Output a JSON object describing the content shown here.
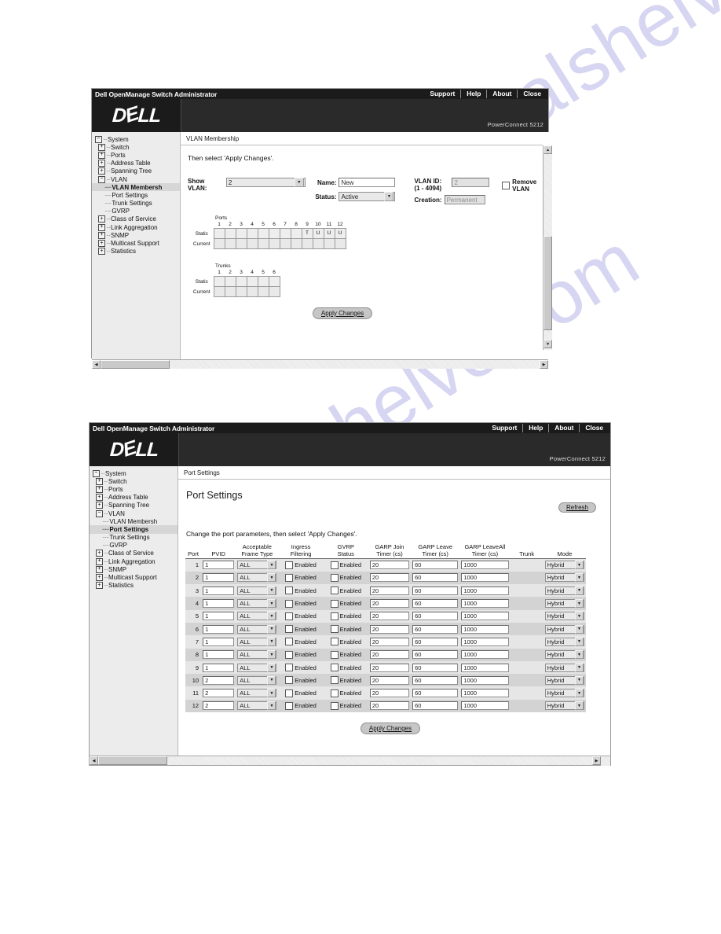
{
  "watermark": {
    "line1": "manualshelve.com",
    "line2": "manualshelve.com"
  },
  "window1": {
    "titlebar": {
      "title": "Dell OpenManage Switch Administrator",
      "links": [
        "Support",
        "Help",
        "About",
        "Close"
      ]
    },
    "banner": {
      "logo": "D⁀LL",
      "model": "PowerConnect 5212"
    },
    "breadcrumb": "VLAN Membership",
    "tree": [
      {
        "label": "System",
        "level": 0,
        "toggle": "−",
        "selected": false
      },
      {
        "label": "Switch",
        "level": 1,
        "toggle": "+",
        "selected": false
      },
      {
        "label": "Ports",
        "level": 1,
        "toggle": "+",
        "selected": false
      },
      {
        "label": "Address Table",
        "level": 1,
        "toggle": "+",
        "selected": false
      },
      {
        "label": "Spanning Tree",
        "level": 1,
        "toggle": "+",
        "selected": false
      },
      {
        "label": "VLAN",
        "level": 1,
        "toggle": "−",
        "selected": false
      },
      {
        "label": "VLAN Membersh",
        "level": 2,
        "toggle": "",
        "selected": true
      },
      {
        "label": "Port Settings",
        "level": 2,
        "toggle": "",
        "selected": false
      },
      {
        "label": "Trunk Settings",
        "level": 2,
        "toggle": "",
        "selected": false
      },
      {
        "label": "GVRP",
        "level": 2,
        "toggle": "",
        "selected": false
      },
      {
        "label": "Class of Service",
        "level": 1,
        "toggle": "+",
        "selected": false
      },
      {
        "label": "Link Aggregation",
        "level": 1,
        "toggle": "+",
        "selected": false
      },
      {
        "label": "SNMP",
        "level": 1,
        "toggle": "+",
        "selected": false
      },
      {
        "label": "Multicast Support",
        "level": 1,
        "toggle": "+",
        "selected": false
      },
      {
        "label": "Statistics",
        "level": 1,
        "toggle": "+",
        "selected": false
      }
    ],
    "instruction": "Then select 'Apply Changes'.",
    "form": {
      "show_vlan_label_l1": "Show",
      "show_vlan_label_l2": "VLAN:",
      "show_vlan_value": "2",
      "name_label": "Name:",
      "name_value": "New",
      "status_label": "Status:",
      "status_value": "Active",
      "vlan_id_label_l1": "VLAN ID:",
      "vlan_id_label_l2": "(1 - 4094)",
      "vlan_id_value": "2",
      "creation_label": "Creation:",
      "creation_value": "Permanent",
      "remove_vlan_label": "Remove VLAN",
      "remove_vlan_checked": false
    },
    "ports_grid": {
      "title": "Ports",
      "columns": [
        "1",
        "2",
        "3",
        "4",
        "5",
        "6",
        "7",
        "8",
        "9",
        "10",
        "11",
        "12"
      ],
      "rows": [
        {
          "label": "Static",
          "values": [
            "",
            "",
            "",
            "",
            "",
            "",
            "",
            "",
            "T",
            "U",
            "U",
            "U"
          ]
        },
        {
          "label": "Current",
          "values": [
            "",
            "",
            "",
            "",
            "",
            "",
            "",
            "",
            "",
            "",
            "",
            ""
          ]
        }
      ]
    },
    "trunks_grid": {
      "title": "Trunks",
      "columns": [
        "1",
        "2",
        "3",
        "4",
        "5",
        "6"
      ],
      "rows": [
        {
          "label": "Static",
          "values": [
            "",
            "",
            "",
            "",
            "",
            ""
          ]
        },
        {
          "label": "Current",
          "values": [
            "",
            "",
            "",
            "",
            "",
            ""
          ]
        }
      ]
    },
    "apply_button": "Apply Changes"
  },
  "window2": {
    "titlebar": {
      "title": "Dell OpenManage Switch Administrator",
      "links": [
        "Support",
        "Help",
        "About",
        "Close"
      ]
    },
    "banner": {
      "logo": "D⁀LL",
      "model": "PowerConnect 5212"
    },
    "breadcrumb": "Port Settings",
    "tree": [
      {
        "label": "System",
        "level": 0,
        "toggle": "−",
        "selected": false
      },
      {
        "label": "Switch",
        "level": 1,
        "toggle": "+",
        "selected": false
      },
      {
        "label": "Ports",
        "level": 1,
        "toggle": "+",
        "selected": false
      },
      {
        "label": "Address Table",
        "level": 1,
        "toggle": "+",
        "selected": false
      },
      {
        "label": "Spanning Tree",
        "level": 1,
        "toggle": "+",
        "selected": false
      },
      {
        "label": "VLAN",
        "level": 1,
        "toggle": "−",
        "selected": false
      },
      {
        "label": "VLAN Membersh",
        "level": 2,
        "toggle": "",
        "selected": false
      },
      {
        "label": "Port Settings",
        "level": 2,
        "toggle": "",
        "selected": true
      },
      {
        "label": "Trunk Settings",
        "level": 2,
        "toggle": "",
        "selected": false
      },
      {
        "label": "GVRP",
        "level": 2,
        "toggle": "",
        "selected": false
      },
      {
        "label": "Class of Service",
        "level": 1,
        "toggle": "+",
        "selected": false
      },
      {
        "label": "Link Aggregation",
        "level": 1,
        "toggle": "+",
        "selected": false
      },
      {
        "label": "SNMP",
        "level": 1,
        "toggle": "+",
        "selected": false
      },
      {
        "label": "Multicast Support",
        "level": 1,
        "toggle": "+",
        "selected": false
      },
      {
        "label": "Statistics",
        "level": 1,
        "toggle": "+",
        "selected": false
      }
    ],
    "page_title": "Port Settings",
    "refresh_button": "Refresh",
    "instruction": "Change the port parameters, then select 'Apply Changes'.",
    "table": {
      "headers": [
        "Port",
        "PVID",
        "Acceptable\nFrame Type",
        "Ingress\nFiltering",
        "GVRP\nStatus",
        "GARP Join\nTimer (cs)",
        "GARP Leave\nTimer (cs)",
        "GARP LeaveAll\nTimer (cs)",
        "Trunk",
        "Mode"
      ],
      "enabled_label": "Enabled",
      "rows": [
        {
          "port": "1",
          "pvid": "1",
          "frame_type": "ALL",
          "ingress_filtering": false,
          "gvrp_status": false,
          "garp_join": "20",
          "garp_leave": "60",
          "garp_leaveall": "1000",
          "trunk": "",
          "mode": "Hybrid"
        },
        {
          "port": "2",
          "pvid": "1",
          "frame_type": "ALL",
          "ingress_filtering": false,
          "gvrp_status": false,
          "garp_join": "20",
          "garp_leave": "60",
          "garp_leaveall": "1000",
          "trunk": "",
          "mode": "Hybrid"
        },
        {
          "port": "3",
          "pvid": "1",
          "frame_type": "ALL",
          "ingress_filtering": false,
          "gvrp_status": false,
          "garp_join": "20",
          "garp_leave": "60",
          "garp_leaveall": "1000",
          "trunk": "",
          "mode": "Hybrid"
        },
        {
          "port": "4",
          "pvid": "1",
          "frame_type": "ALL",
          "ingress_filtering": false,
          "gvrp_status": false,
          "garp_join": "20",
          "garp_leave": "60",
          "garp_leaveall": "1000",
          "trunk": "",
          "mode": "Hybrid"
        },
        {
          "port": "5",
          "pvid": "1",
          "frame_type": "ALL",
          "ingress_filtering": false,
          "gvrp_status": false,
          "garp_join": "20",
          "garp_leave": "60",
          "garp_leaveall": "1000",
          "trunk": "",
          "mode": "Hybrid"
        },
        {
          "port": "6",
          "pvid": "1",
          "frame_type": "ALL",
          "ingress_filtering": false,
          "gvrp_status": false,
          "garp_join": "20",
          "garp_leave": "60",
          "garp_leaveall": "1000",
          "trunk": "",
          "mode": "Hybrid"
        },
        {
          "port": "7",
          "pvid": "1",
          "frame_type": "ALL",
          "ingress_filtering": false,
          "gvrp_status": false,
          "garp_join": "20",
          "garp_leave": "60",
          "garp_leaveall": "1000",
          "trunk": "",
          "mode": "Hybrid"
        },
        {
          "port": "8",
          "pvid": "1",
          "frame_type": "ALL",
          "ingress_filtering": false,
          "gvrp_status": false,
          "garp_join": "20",
          "garp_leave": "60",
          "garp_leaveall": "1000",
          "trunk": "",
          "mode": "Hybrid"
        },
        {
          "port": "9",
          "pvid": "1",
          "frame_type": "ALL",
          "ingress_filtering": false,
          "gvrp_status": false,
          "garp_join": "20",
          "garp_leave": "60",
          "garp_leaveall": "1000",
          "trunk": "",
          "mode": "Hybrid"
        },
        {
          "port": "10",
          "pvid": "2",
          "frame_type": "ALL",
          "ingress_filtering": false,
          "gvrp_status": false,
          "garp_join": "20",
          "garp_leave": "60",
          "garp_leaveall": "1000",
          "trunk": "",
          "mode": "Hybrid"
        },
        {
          "port": "11",
          "pvid": "2",
          "frame_type": "ALL",
          "ingress_filtering": false,
          "gvrp_status": false,
          "garp_join": "20",
          "garp_leave": "60",
          "garp_leaveall": "1000",
          "trunk": "",
          "mode": "Hybrid"
        },
        {
          "port": "12",
          "pvid": "2",
          "frame_type": "ALL",
          "ingress_filtering": false,
          "gvrp_status": false,
          "garp_join": "20",
          "garp_leave": "60",
          "garp_leaveall": "1000",
          "trunk": "",
          "mode": "Hybrid"
        }
      ]
    },
    "apply_button": "Apply Changes"
  }
}
